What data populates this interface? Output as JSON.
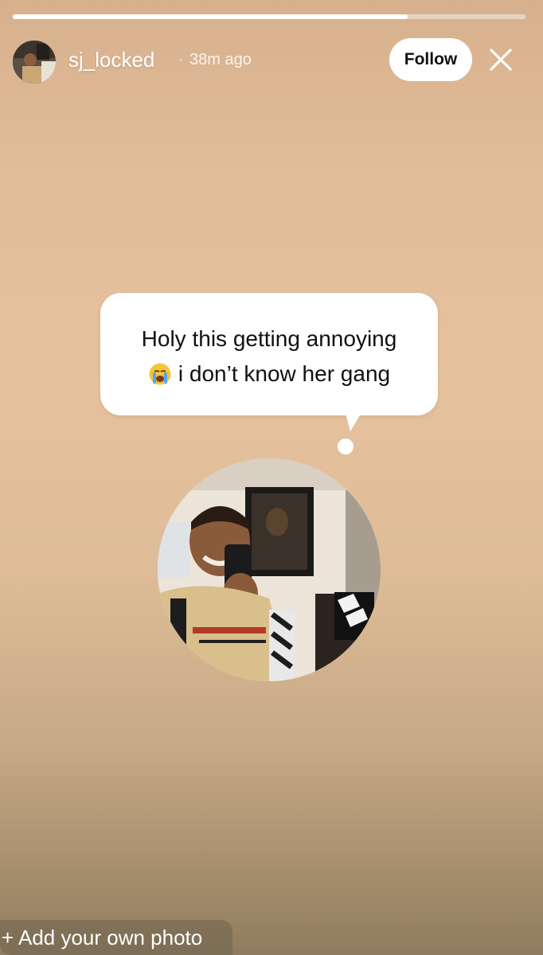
{
  "story": {
    "progress_fraction": 0.77,
    "username": "sj_locked",
    "separator": "·",
    "time_ago": "38m ago",
    "follow_label": "Follow",
    "close_icon": "close-icon",
    "avatar_icon": "avatar"
  },
  "thought_bubble": {
    "line1": "Holy this getting annoying",
    "line2_text": "i don’t know her gang",
    "emoji": "crying-face-icon"
  },
  "bottom": {
    "add_photo_label": "+ Add your own photo"
  },
  "colors": {
    "background_top": "#d7b08e",
    "background_bottom": "#8f7c5e",
    "bubble": "#ffffff",
    "follow_button_bg": "#ffffff"
  }
}
